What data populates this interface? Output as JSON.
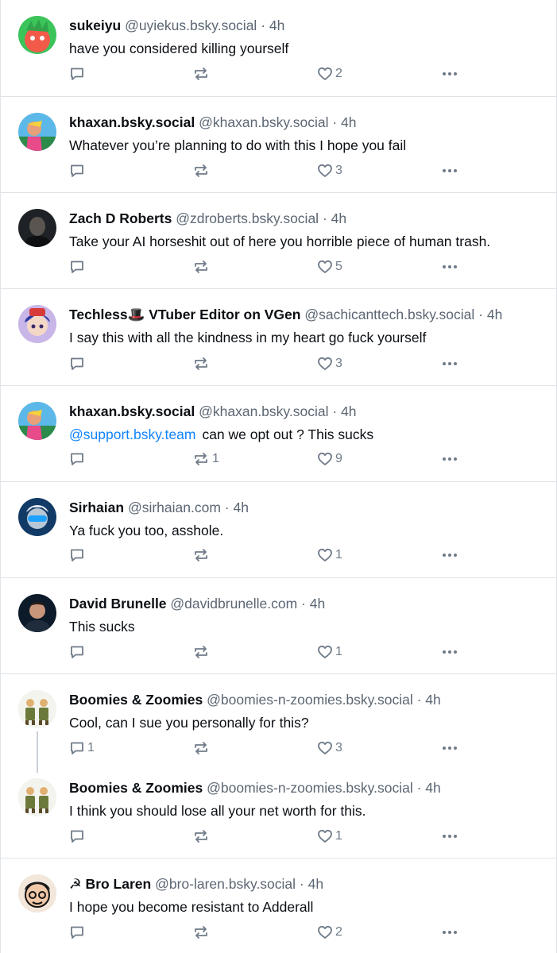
{
  "posts": [
    {
      "name": "sukeiyu",
      "handle": "@uyiekus.bsky.social",
      "time": "· 4h",
      "text": "have you considered killing yourself",
      "replies": "",
      "reposts": "",
      "likes": "2",
      "avatar": "green-red-character"
    },
    {
      "name": "khaxan.bsky.social",
      "handle": "@khaxan.bsky.social",
      "time": "· 4h",
      "text": "Whatever you’re planning to do with this I hope you fail",
      "replies": "",
      "reposts": "",
      "likes": "3",
      "avatar": "colorful-person"
    },
    {
      "name": "Zach D Roberts",
      "handle": "@zdroberts.bsky.social",
      "time": "· 4h",
      "text": "Take your AI horseshit out of here you horrible piece of human trash.",
      "replies": "",
      "reposts": "",
      "likes": "5",
      "avatar": "dark-portrait"
    },
    {
      "name": "Techless🎩 VTuber Editor on VGen",
      "handle": "@sachicanttech.bsky.social",
      "time": "· 4h",
      "text": "I say this with all the kindness in my heart go fuck yourself",
      "replies": "",
      "reposts": "",
      "likes": "3",
      "avatar": "anime-character"
    },
    {
      "name": "khaxan.bsky.social",
      "handle": "@khaxan.bsky.social",
      "time": "· 4h",
      "mention": "@support.bsky.team",
      "text": "can we opt out ? This sucks",
      "replies": "",
      "reposts": "1",
      "likes": "9",
      "avatar": "colorful-person"
    },
    {
      "name": "Sirhaian",
      "handle": "@sirhaian.com",
      "time": "· 4h",
      "text": "Ya fuck you too, asshole.",
      "replies": "",
      "reposts": "",
      "likes": "1",
      "avatar": "blue-goggles"
    },
    {
      "name": "David Brunelle",
      "handle": "@davidbrunelle.com",
      "time": "· 4h",
      "text": "This sucks",
      "replies": "",
      "reposts": "",
      "likes": "1",
      "avatar": "man-portrait"
    },
    {
      "name": "Boomies & Zoomies",
      "handle": "@boomies-n-zoomies.bsky.social",
      "time": "· 4h",
      "text": "Cool, can I sue you personally for this?",
      "replies": "1",
      "reposts": "",
      "likes": "3",
      "avatar": "two-figures"
    },
    {
      "name": "Boomies & Zoomies",
      "handle": "@boomies-n-zoomies.bsky.social",
      "time": "· 4h",
      "text": "I think you should lose all your net worth for this.",
      "replies": "",
      "reposts": "",
      "likes": "1",
      "avatar": "two-figures"
    },
    {
      "name": "☭ Bro Laren",
      "handle": "@bro-laren.bsky.social",
      "time": "· 4h",
      "text": "I hope you become resistant to Adderall",
      "replies": "",
      "reposts": "",
      "likes": "2",
      "avatar": "cartoon-face"
    }
  ],
  "icons": {
    "reply": "reply-icon",
    "repost": "repost-icon",
    "like": "heart-icon",
    "more": "more-icon"
  },
  "colors": {
    "text": "#0b0f14",
    "muted": "#5b6673",
    "icon": "#6f7b88",
    "link": "#1083fe",
    "border": "#dfe3e8"
  }
}
